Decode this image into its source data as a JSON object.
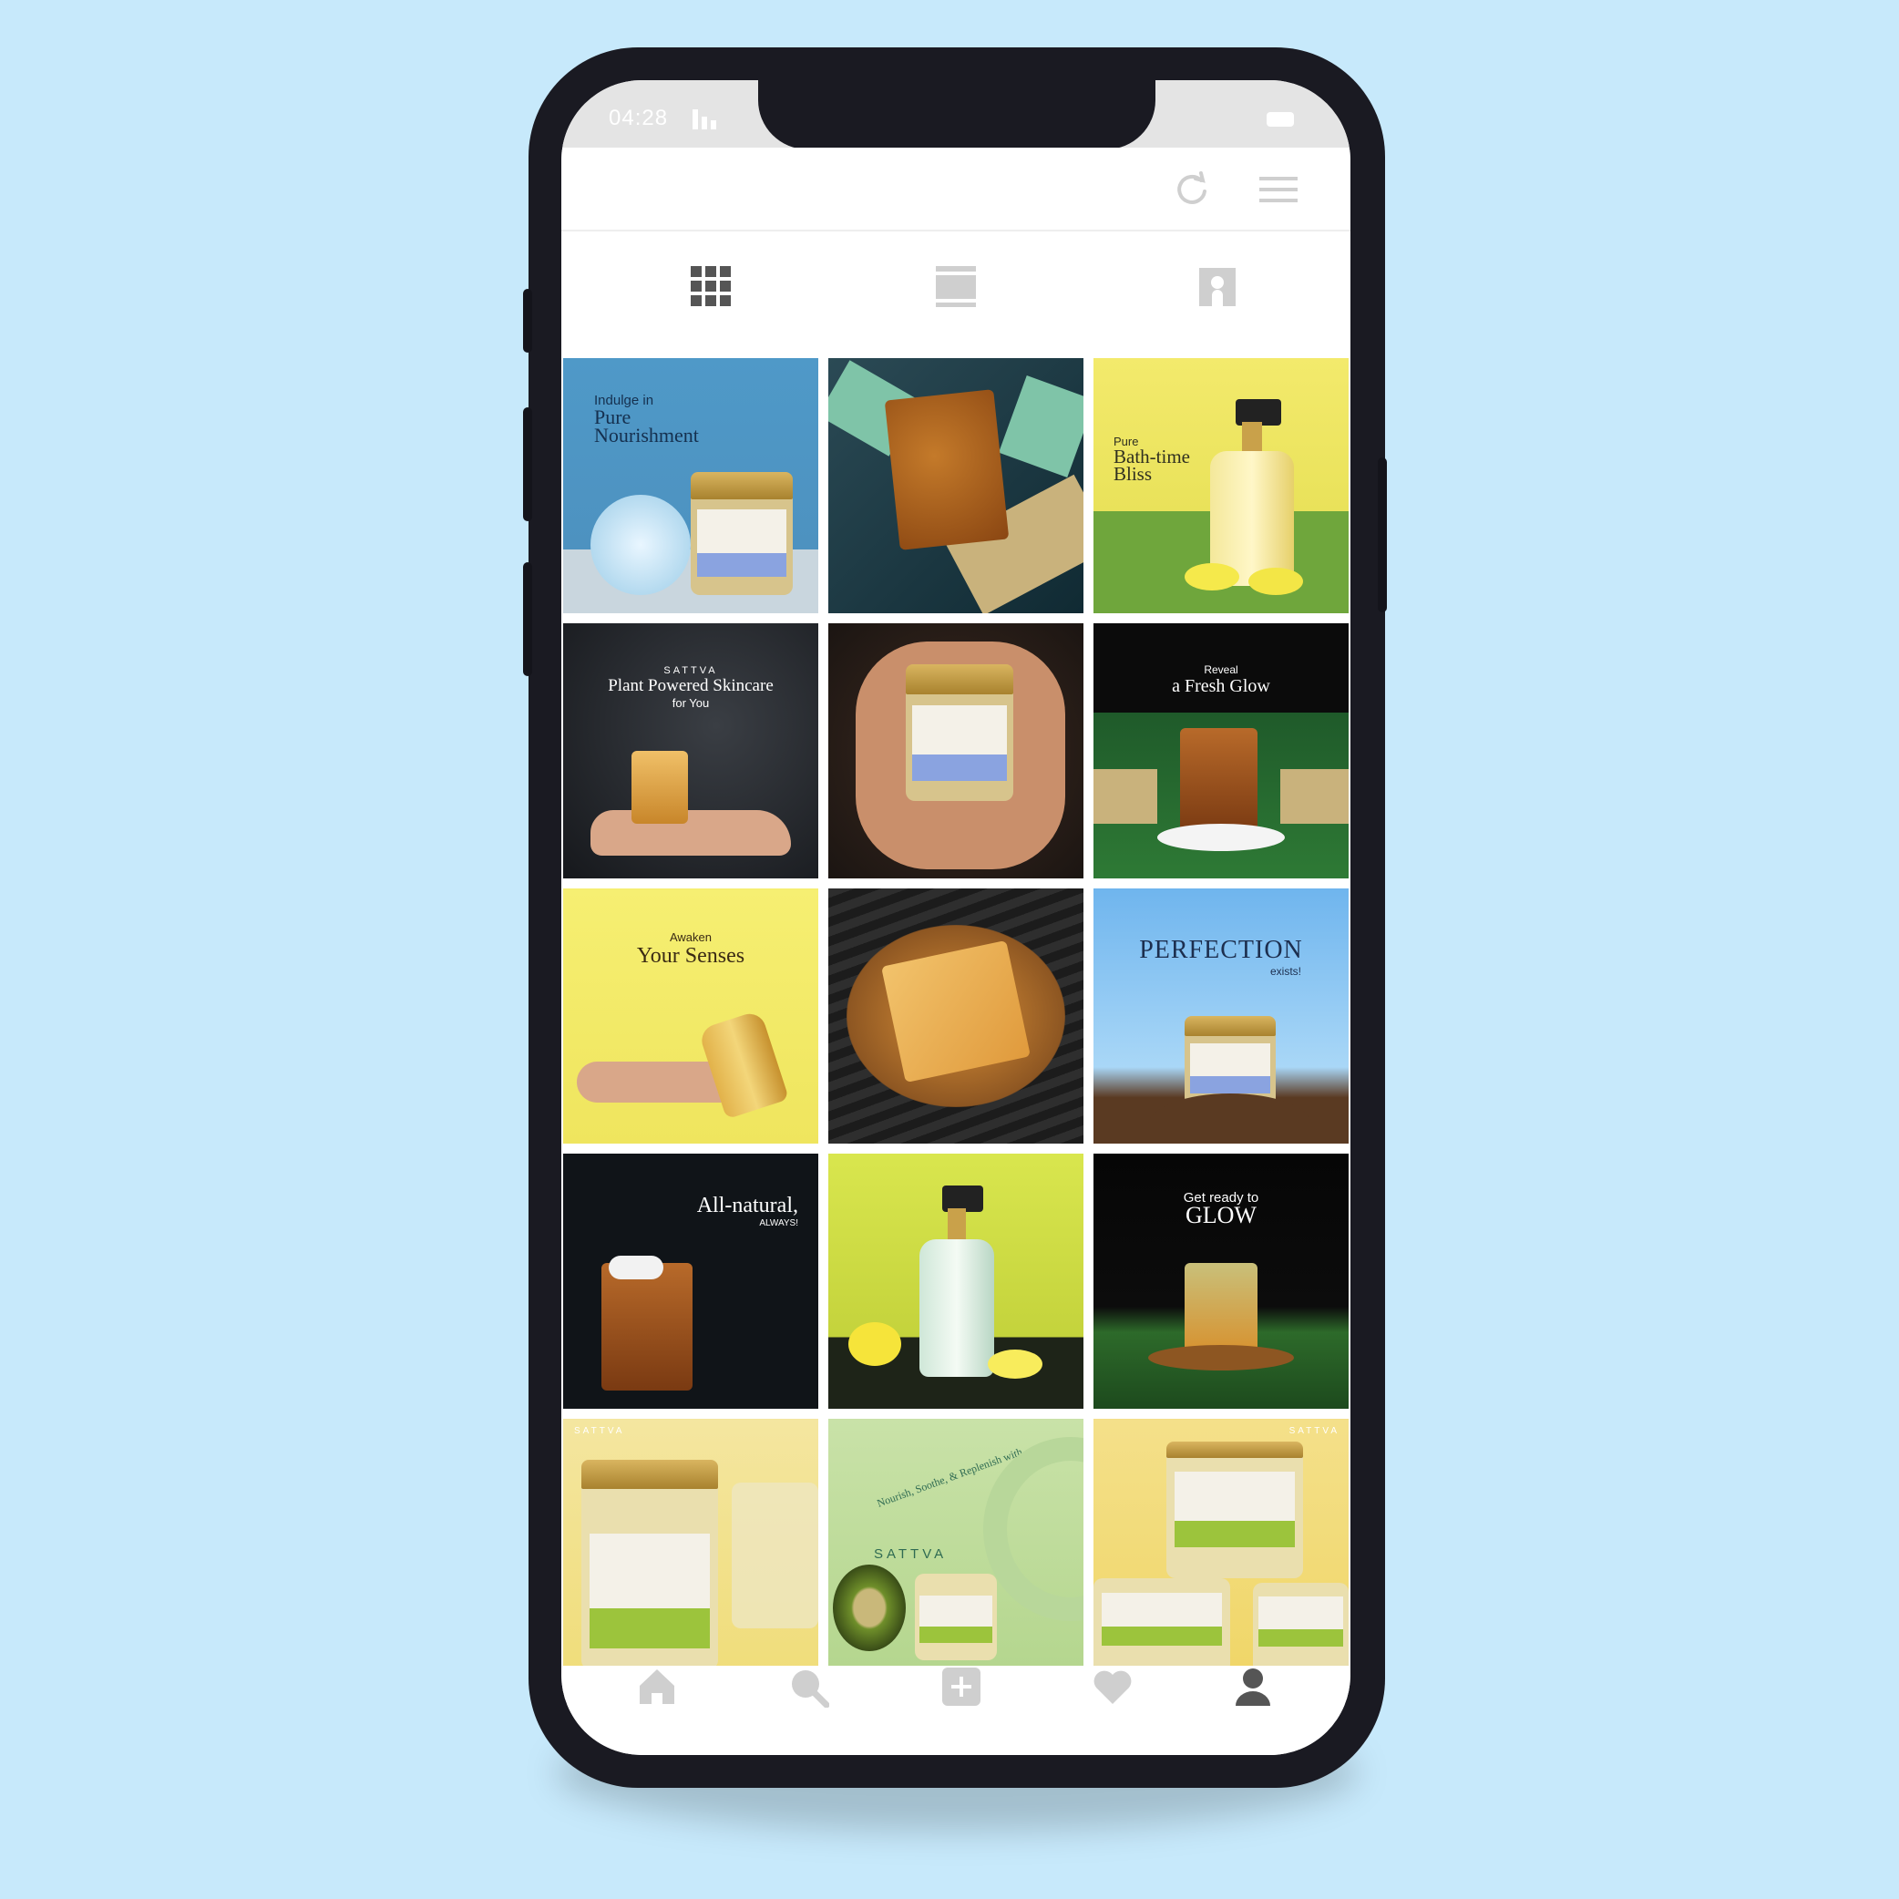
{
  "status_bar": {
    "time": "04:28"
  },
  "tabs": [
    {
      "icon": "grid-icon",
      "active": true
    },
    {
      "icon": "feed-icon",
      "active": false
    },
    {
      "icon": "tagged-icon",
      "active": false
    }
  ],
  "posts": [
    {
      "line1": "Indulge in",
      "line2": "Pure",
      "line3": "Nourishment"
    },
    {
      "line1": "",
      "line2": "",
      "line3": ""
    },
    {
      "line1": "Pure",
      "line2": "Bath-time",
      "line3": "Bliss"
    },
    {
      "line1": "SATTVA",
      "line2": "Plant Powered Skincare",
      "line3": "for You"
    },
    {
      "line1": "",
      "line2": "",
      "line3": ""
    },
    {
      "line1": "Reveal",
      "line2": "a Fresh Glow",
      "line3": ""
    },
    {
      "line1": "Awaken",
      "line2": "Your Senses",
      "line3": ""
    },
    {
      "line1": "",
      "line2": "",
      "line3": ""
    },
    {
      "line1": "PERFECTION",
      "line2": "exists!",
      "line3": ""
    },
    {
      "line1": "All-natural,",
      "line2": "ALWAYS!",
      "line3": ""
    },
    {
      "line1": "",
      "line2": "",
      "line3": ""
    },
    {
      "line1": "Get ready to",
      "line2": "GLOW",
      "line3": ""
    },
    {
      "line1": "SATTVA",
      "line2": "",
      "line3": ""
    },
    {
      "line1": "Nourish, Soothe, & Replenish with",
      "line2": "SATTVA",
      "line3": ""
    },
    {
      "line1": "SATTVA",
      "line2": "",
      "line3": ""
    }
  ],
  "bottom_nav": [
    {
      "icon": "home-icon"
    },
    {
      "icon": "search-icon"
    },
    {
      "icon": "add-icon"
    },
    {
      "icon": "heart-icon"
    },
    {
      "icon": "profile-icon"
    }
  ],
  "colors": {
    "background": "#c7e9fb",
    "phone_frame": "#1a1a22",
    "status_bar": "#e4e4e4",
    "icon_gray": "#c8c8c8",
    "icon_active": "#555555"
  }
}
